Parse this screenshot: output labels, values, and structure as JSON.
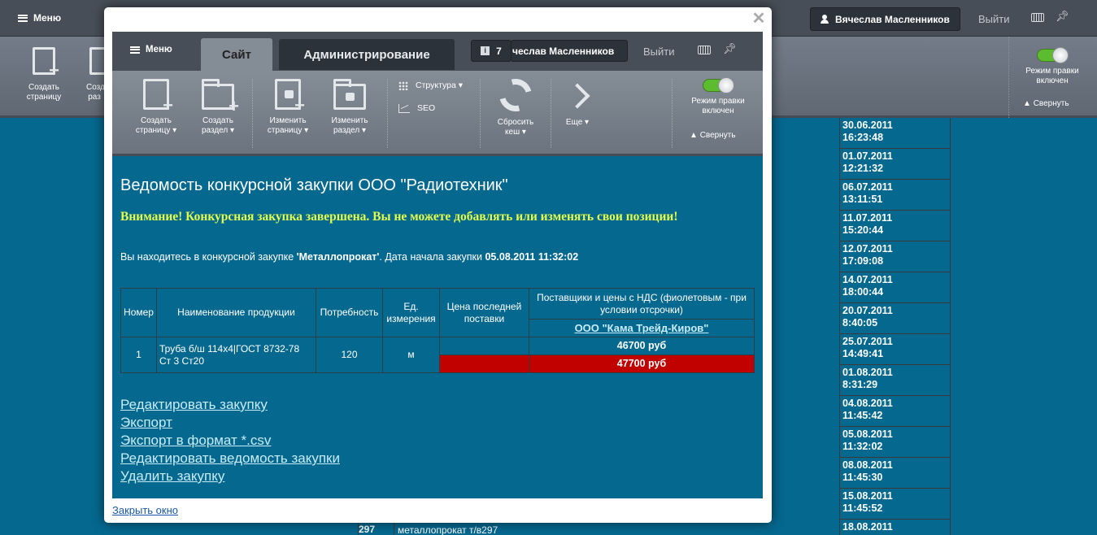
{
  "background": {
    "menu_label": "Меню",
    "user_name": "Вячеслав Масленников",
    "exit_label": "Выйти",
    "toolbar": {
      "create_page": "Создать страницу",
      "create_section_partial": "Созд раз",
      "edit_mode_label": "Режим правки включен",
      "collapse_label": "Свернуть"
    },
    "dates_table": [
      {
        "date": "30.06.2011",
        "time": "16:23:48"
      },
      {
        "date": "01.07.2011",
        "time": "12:21:32"
      },
      {
        "date": "06.07.2011",
        "time": "13:11:51"
      },
      {
        "date": "11.07.2011",
        "time": "15:20:44"
      },
      {
        "date": "12.07.2011",
        "time": "17:09:08"
      },
      {
        "date": "14.07.2011",
        "time": "18:00:44"
      },
      {
        "date": "20.07.2011",
        "time": "8:40:05"
      },
      {
        "date": "25.07.2011",
        "time": "14:49:41"
      },
      {
        "date": "01.08.2011",
        "time": "8:31:29"
      },
      {
        "date": "04.08.2011",
        "time": "11:45:42"
      },
      {
        "date": "05.08.2011",
        "time": "11:32:02"
      },
      {
        "date": "08.08.2011",
        "time": "11:45:30"
      },
      {
        "date": "15.08.2011",
        "time": "11:45:52"
      },
      {
        "date": "18.08.2011",
        "time": ""
      }
    ],
    "partial_row": {
      "num": "297",
      "name": "металлопрокат т/в297"
    }
  },
  "modal": {
    "close_link": "Закрыть окно",
    "admin": {
      "menu_label": "Меню",
      "tab_site": "Сайт",
      "tab_admin": "Администрирование",
      "notifications_count": "7",
      "user_name_visible": "чеслав Масленников",
      "exit_label": "Выйти",
      "tools": {
        "create_page_1": "Создать",
        "create_page_2": "страницу",
        "create_section_1": "Создать",
        "create_section_2": "раздел",
        "edit_page_1": "Изменить",
        "edit_page_2": "страницу",
        "edit_section_1": "Изменить",
        "edit_section_2": "раздел",
        "structure": "Структура",
        "seo": "SEO",
        "reset_cache_1": "Сбросить",
        "reset_cache_2": "кеш",
        "more": "Еще",
        "edit_mode_1": "Режим правки",
        "edit_mode_2": "включен",
        "collapse": "Свернуть"
      }
    },
    "content": {
      "title": "Ведомость конкурсной закупки ООО \"Радиотехник\"",
      "warning": "Внимание! Конкурсная закупка завершена. Вы не можете добавлять или изменять свои позиции!",
      "info_prefix": "Вы находитесь в конкурсной закупке ",
      "info_purchase": "'Металлопрокат'",
      "info_middle": ". Дата начала закупки ",
      "info_date": "05.08.2011 11:32:02",
      "table": {
        "headers": {
          "num": "Номер",
          "name": "Наименование продукции",
          "need": "Потребность",
          "unit": "Ед. измерения",
          "last_price": "Цена последней поставки",
          "suppliers": "Поставщики и цены с НДС (фиолетовым - при условии отсрочки)"
        },
        "supplier": "ООО \"Кама Трейд-Киров\"",
        "row": {
          "num": "1",
          "name": "Труба б/ш 114х4|ГОСТ 8732-78 Ст 3 Ст20",
          "need": "120",
          "unit": "м",
          "last_price": "",
          "price_1": "46700 руб",
          "price_2": "47700 руб"
        }
      },
      "actions": [
        "Редактировать закупку",
        "Экспорт",
        "Экспорт в формат *.csv",
        "Редактировать ведомость закупки",
        "Удалить закупку"
      ]
    }
  },
  "colors": {
    "background_blue": "#05688f",
    "warning_yellow": "#e4ff4a",
    "alert_red": "#c10000",
    "toggle_green": "#5dbb2f"
  }
}
